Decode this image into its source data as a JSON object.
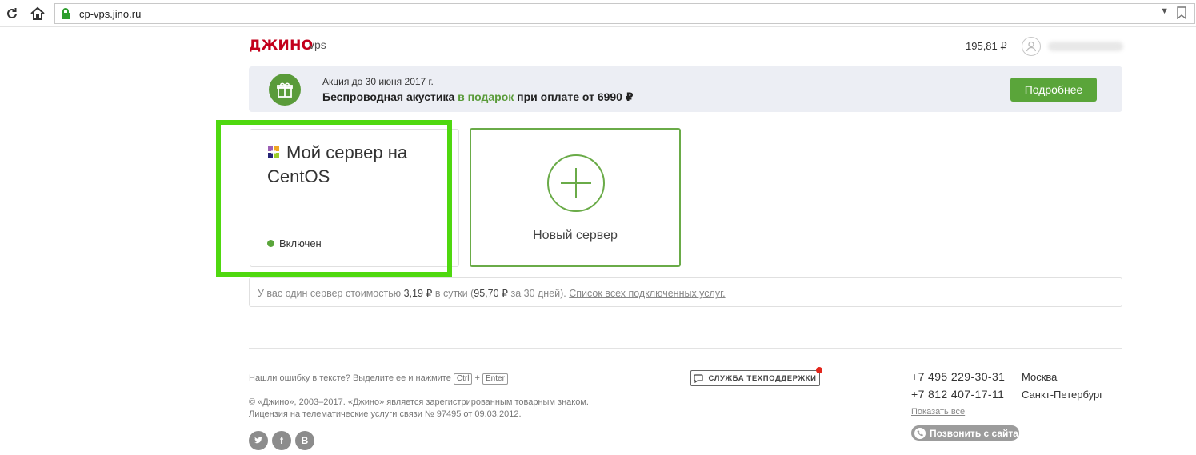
{
  "browser": {
    "url": "cp-vps.jino.ru"
  },
  "header": {
    "logo": "ДЖИНО",
    "logo_sub": "vps",
    "balance": "195,81 ₽"
  },
  "promo": {
    "small_text": "Акция до 30 июня 2017 г.",
    "big_part1": "Беспроводная акустика ",
    "big_highlight": "в подарок",
    "big_part2": " при оплате от 6990 ₽",
    "button_label": "Подробнее"
  },
  "server": {
    "name": "Мой сервер на CentOS",
    "status": "Включен"
  },
  "new_server": {
    "label": "Новый сервер"
  },
  "info": {
    "part1": "У вас один сервер стоимостью ",
    "price_day": "3,19 ₽",
    "part2": " в сутки (",
    "price_30": "95,70 ₽",
    "part3": " за 30 дней). ",
    "link": "Список всех подключенных услуг."
  },
  "footer": {
    "error_text": "Нашли ошибку в тексте? Выделите ее и нажмите",
    "key_ctrl": "Ctrl",
    "key_plus": "+",
    "key_enter": "Enter",
    "copyright": "© «Джино», 2003–2017. «Джино» является зарегистрированным товарным знаком.",
    "license": "Лицензия на телематические услуги связи № 97495 от 09.03.2012.",
    "support_label": "СЛУЖБА ТЕХПОДДЕРЖКИ",
    "phones": [
      {
        "number": "+7 495 229-30-31",
        "city": "Москва"
      },
      {
        "number": "+7 812 407-17-11",
        "city": "Санкт-Петербург"
      }
    ],
    "show_all": "Показать все",
    "call_label": "Позвонить с сайта",
    "social": [
      "twitter",
      "facebook",
      "vk"
    ]
  },
  "colors": {
    "brand_red": "#c3001b",
    "accent_green": "#5aa53a",
    "highlight_green": "#4fd80f"
  }
}
